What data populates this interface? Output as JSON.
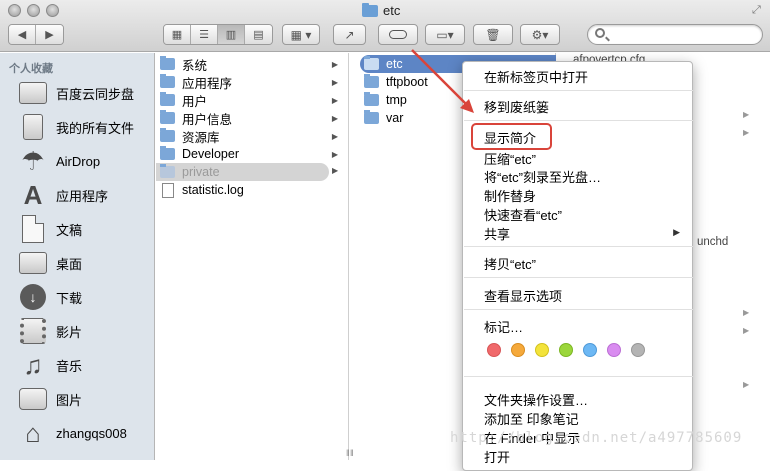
{
  "window": {
    "title": "etc"
  },
  "toolbar": {
    "back_icon": "chevron-left-icon",
    "forward_icon": "chevron-right-icon",
    "view_modes": [
      "icon-view",
      "list-view",
      "column-view",
      "cover-flow-view"
    ],
    "arrange_icon": "grid-arrange-icon",
    "share_icon": "share-icon",
    "tag_icon": "tag-icon",
    "new_folder_icon": "new-folder-icon",
    "trash_icon": "trash-icon",
    "action_icon": "gear-icon",
    "search_placeholder": ""
  },
  "sidebar": {
    "heading": "个人收藏",
    "items": [
      {
        "label": "百度云同步盘",
        "icon": "folder-icon"
      },
      {
        "label": "我的所有文件",
        "icon": "all-files-icon"
      },
      {
        "label": "AirDrop",
        "icon": "airdrop-icon"
      },
      {
        "label": "应用程序",
        "icon": "applications-icon"
      },
      {
        "label": "文稿",
        "icon": "documents-icon"
      },
      {
        "label": "桌面",
        "icon": "desktop-icon"
      },
      {
        "label": "下载",
        "icon": "downloads-icon"
      },
      {
        "label": "影片",
        "icon": "movies-icon"
      },
      {
        "label": "音乐",
        "icon": "music-icon"
      },
      {
        "label": "图片",
        "icon": "pictures-icon"
      },
      {
        "label": "zhangqs008",
        "icon": "home-icon"
      }
    ]
  },
  "column1": {
    "items": [
      {
        "label": "系统",
        "type": "folder",
        "arrow": true
      },
      {
        "label": "应用程序",
        "type": "folder",
        "arrow": true
      },
      {
        "label": "用户",
        "type": "folder",
        "arrow": true
      },
      {
        "label": "用户信息",
        "type": "folder",
        "arrow": true
      },
      {
        "label": "资源库",
        "type": "folder",
        "arrow": true
      },
      {
        "label": "Developer",
        "type": "folder",
        "arrow": true
      },
      {
        "label": "private",
        "type": "folder",
        "arrow": true,
        "selected": true
      },
      {
        "label": "statistic.log",
        "type": "file",
        "arrow": false
      }
    ]
  },
  "column2": {
    "items": [
      {
        "label": "etc",
        "type": "folder",
        "arrow": true,
        "selected": true
      },
      {
        "label": "tftpboot",
        "type": "folder",
        "arrow": true
      },
      {
        "label": "tmp",
        "type": "folder",
        "arrow": true
      },
      {
        "label": "var",
        "type": "folder",
        "arrow": true
      }
    ]
  },
  "column3": {
    "first_item": "afpovertcp.cfg",
    "last_visible": "unchd"
  },
  "context_menu": {
    "items": [
      {
        "label": "在新标签页中打开"
      },
      {
        "label": "移到废纸篓"
      },
      {
        "label": "显示简介",
        "highlighted": true
      },
      {
        "label": "压缩“etc”"
      },
      {
        "label": "将“etc”刻录至光盘…"
      },
      {
        "label": "制作替身"
      },
      {
        "label": "快速查看“etc”"
      },
      {
        "label": "共享",
        "submenu": true
      },
      {
        "label": "拷贝“etc”"
      },
      {
        "label": "查看显示选项"
      },
      {
        "label": "标记…"
      },
      {
        "label": "文件夹操作设置…"
      },
      {
        "label": "添加至 印象笔记"
      },
      {
        "label": "在 Finder 中显示"
      },
      {
        "label": "打开"
      }
    ],
    "tag_colors": [
      "#f0696b",
      "#f5a93b",
      "#f3e33b",
      "#9bd63b",
      "#6db8f4",
      "#d98cf0",
      "#b4b4b4"
    ],
    "highlight_color": "#d9443a"
  },
  "watermark": "http://blog.csdn.net/a497785609"
}
